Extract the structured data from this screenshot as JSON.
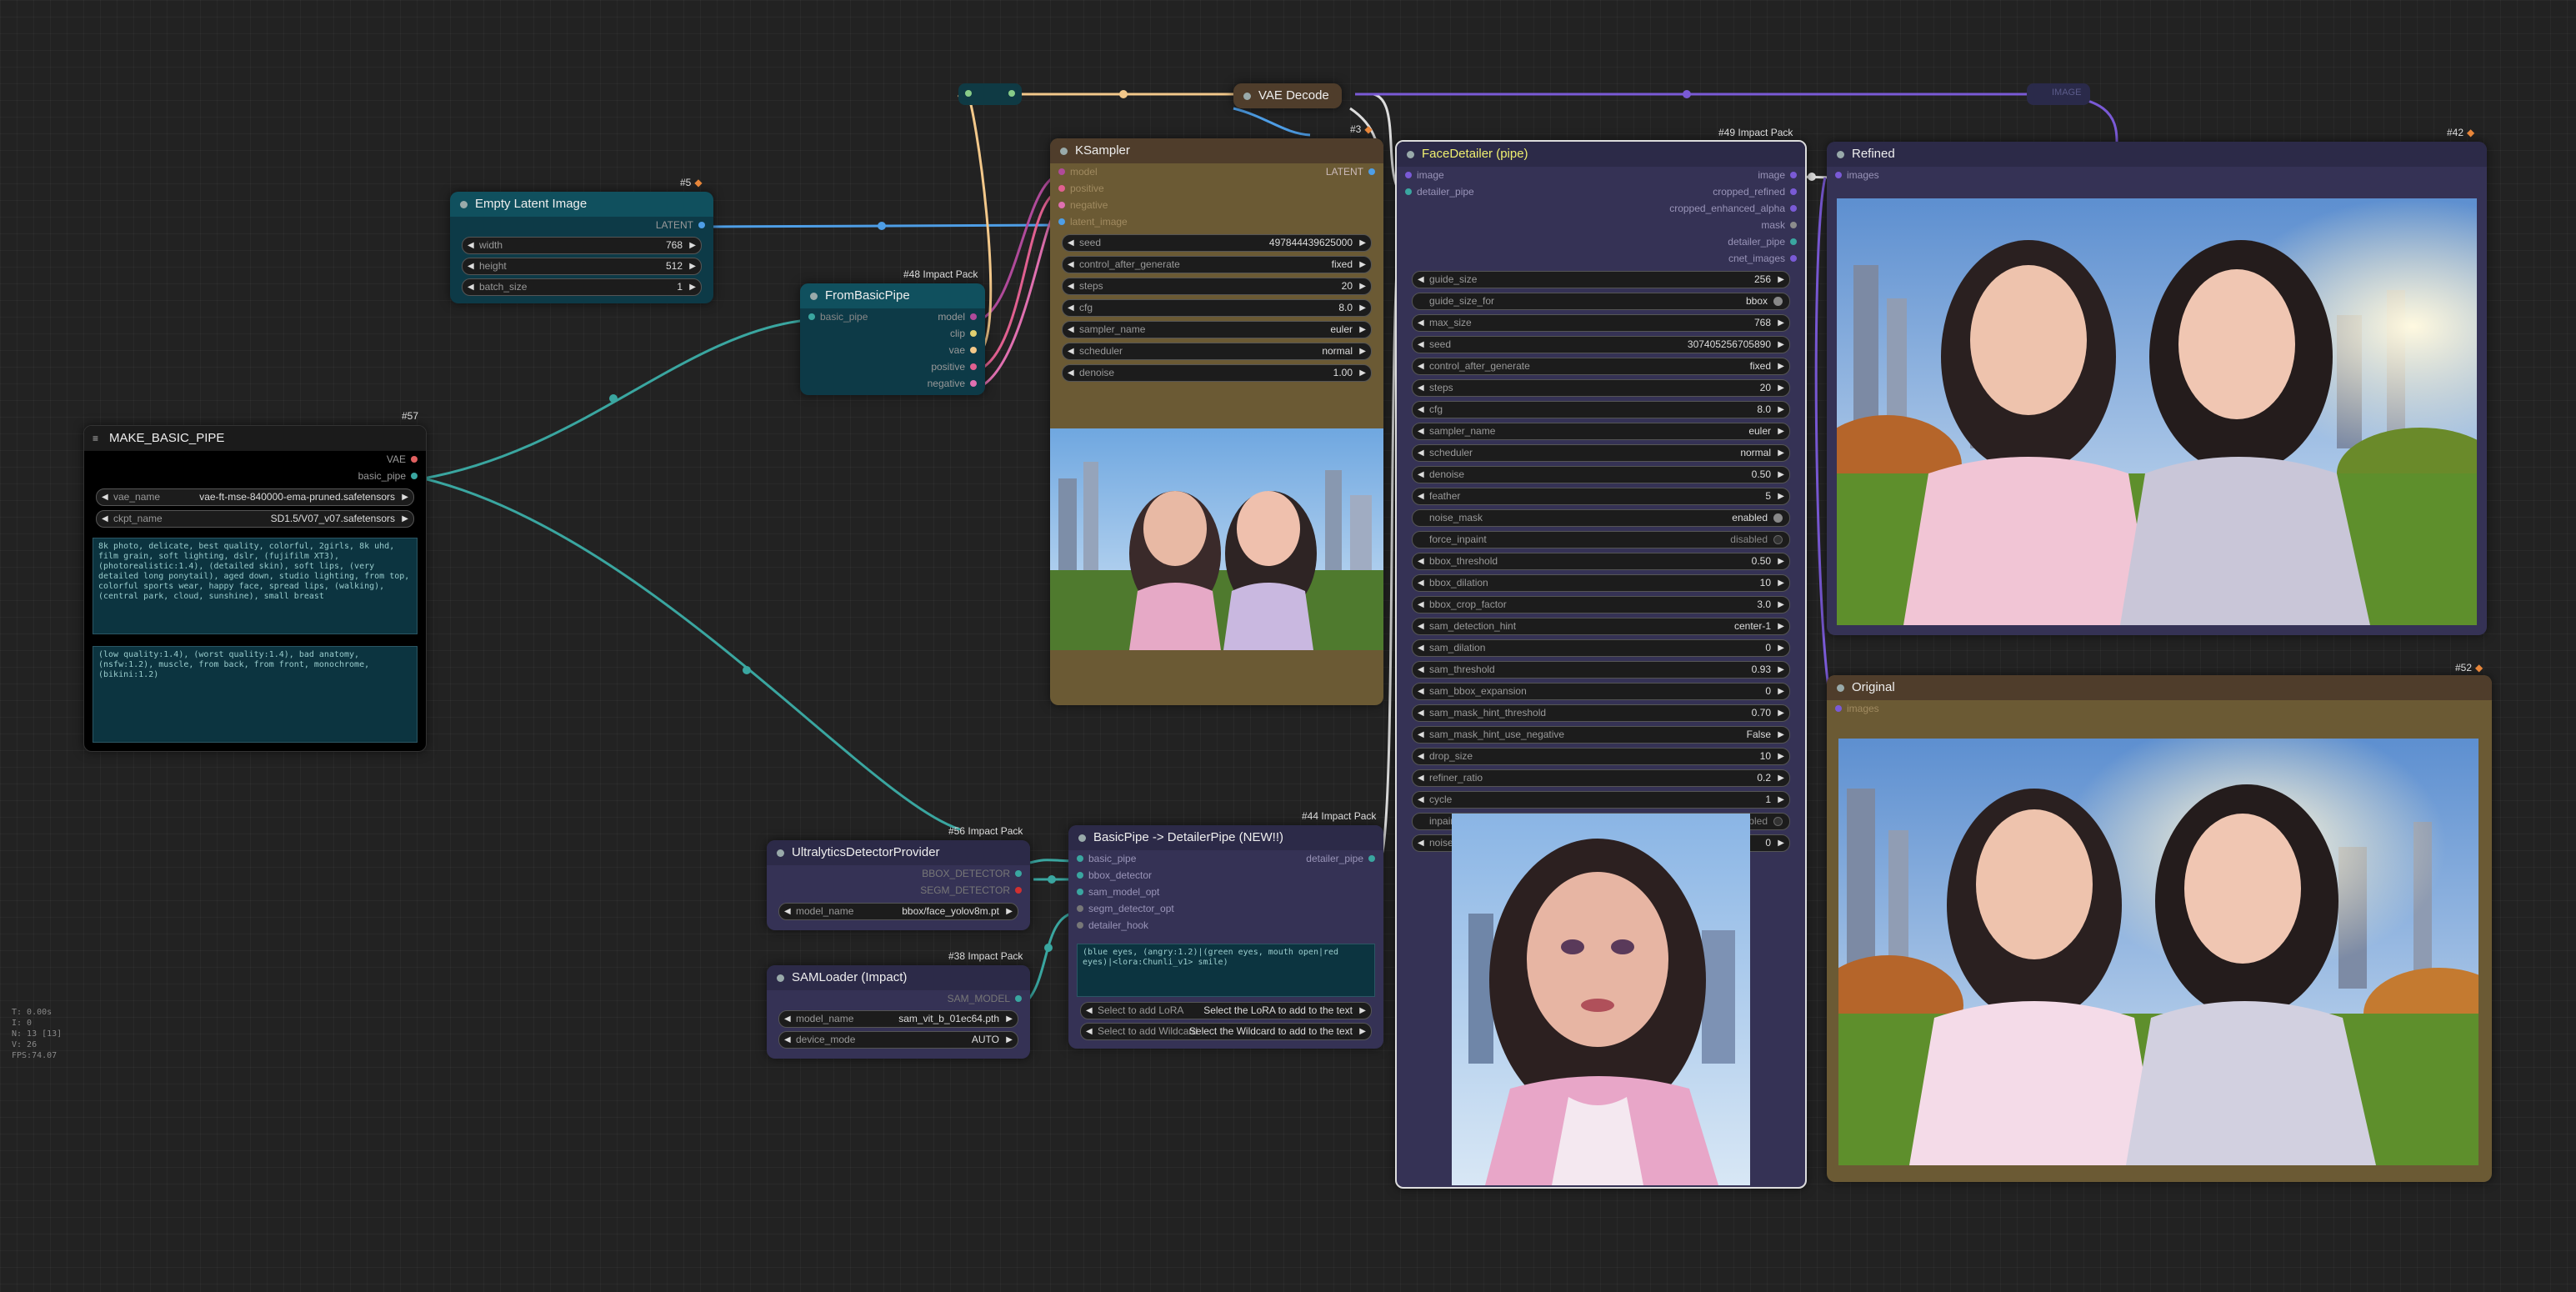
{
  "stats": {
    "lines": [
      "T: 0.00s",
      "I: 0",
      "N: 13 [13]",
      "V: 26",
      "FPS:74.07"
    ]
  },
  "groups": {
    "image_link_label": "IMAGE"
  },
  "colors": {
    "accent_link": "#3aa6a0",
    "latent_link": "#4e9ee6",
    "vae_link": "#e06060",
    "image_link": "#7a5ad6"
  },
  "nodes": {
    "make_basic_pipe": {
      "id": "#57",
      "title": "MAKE_BASIC_PIPE",
      "outputs": [
        "VAE",
        "basic_pipe"
      ],
      "widgets": [
        {
          "label": "vae_name",
          "value": "vae-ft-mse-840000-ema-pruned.safetensors"
        },
        {
          "label": "ckpt_name",
          "value": "SD1.5/V07_v07.safetensors"
        }
      ],
      "positive": "8k photo, delicate, best quality, colorful, 2girls, 8k uhd, film grain, soft lighting, dslr, (fujifilm XT3), (photorealistic:1.4), (detailed skin), soft lips, (very detailed long ponytail), aged down, studio lighting, from top, colorful sports wear, happy face, spread lips, (walking), (central park, cloud, sunshine), small breast",
      "negative": "(low quality:1.4), (worst quality:1.4), bad anatomy, (nsfw:1.2), muscle, from back, from front, monochrome, (bikini:1.2)"
    },
    "empty_latent": {
      "id": "#5",
      "title": "Empty Latent Image",
      "output": "LATENT",
      "widgets": [
        {
          "label": "width",
          "value": "768"
        },
        {
          "label": "height",
          "value": "512"
        },
        {
          "label": "batch_size",
          "value": "1"
        }
      ]
    },
    "from_basic_pipe": {
      "id": "#48 Impact Pack",
      "title": "FromBasicPipe",
      "input": "basic_pipe",
      "outputs": [
        "model",
        "clip",
        "vae",
        "positive",
        "negative"
      ]
    },
    "ksampler": {
      "id": "#3",
      "title": "KSampler",
      "inputs": [
        "model",
        "positive",
        "negative",
        "latent_image"
      ],
      "output": "LATENT",
      "widgets": [
        {
          "label": "seed",
          "value": "497844439625000"
        },
        {
          "label": "control_after_generate",
          "value": "fixed"
        },
        {
          "label": "steps",
          "value": "20"
        },
        {
          "label": "cfg",
          "value": "8.0"
        },
        {
          "label": "sampler_name",
          "value": "euler"
        },
        {
          "label": "scheduler",
          "value": "normal"
        },
        {
          "label": "denoise",
          "value": "1.00"
        }
      ]
    },
    "vae_decode": {
      "title": "VAE Decode"
    },
    "face_detailer": {
      "id": "#49 Impact Pack",
      "title": "FaceDetailer (pipe)",
      "inputs": [
        "image",
        "detailer_pipe"
      ],
      "outputs": [
        "image",
        "cropped_refined",
        "cropped_enhanced_alpha",
        "mask",
        "detailer_pipe",
        "cnet_images"
      ],
      "widgets": [
        {
          "label": "guide_size",
          "value": "256",
          "kind": "num"
        },
        {
          "label": "guide_size_for",
          "value": "bbox",
          "kind": "toggle"
        },
        {
          "label": "max_size",
          "value": "768",
          "kind": "num"
        },
        {
          "label": "seed",
          "value": "307405256705890",
          "kind": "num"
        },
        {
          "label": "control_after_generate",
          "value": "fixed",
          "kind": "num"
        },
        {
          "label": "steps",
          "value": "20",
          "kind": "num"
        },
        {
          "label": "cfg",
          "value": "8.0",
          "kind": "num"
        },
        {
          "label": "sampler_name",
          "value": "euler",
          "kind": "num"
        },
        {
          "label": "scheduler",
          "value": "normal",
          "kind": "num"
        },
        {
          "label": "denoise",
          "value": "0.50",
          "kind": "num"
        },
        {
          "label": "feather",
          "value": "5",
          "kind": "num"
        },
        {
          "label": "noise_mask",
          "value": "enabled",
          "kind": "toggle"
        },
        {
          "label": "force_inpaint",
          "value": "disabled",
          "kind": "toggle-off"
        },
        {
          "label": "bbox_threshold",
          "value": "0.50",
          "kind": "num"
        },
        {
          "label": "bbox_dilation",
          "value": "10",
          "kind": "num"
        },
        {
          "label": "bbox_crop_factor",
          "value": "3.0",
          "kind": "num"
        },
        {
          "label": "sam_detection_hint",
          "value": "center-1",
          "kind": "num"
        },
        {
          "label": "sam_dilation",
          "value": "0",
          "kind": "num"
        },
        {
          "label": "sam_threshold",
          "value": "0.93",
          "kind": "num"
        },
        {
          "label": "sam_bbox_expansion",
          "value": "0",
          "kind": "num"
        },
        {
          "label": "sam_mask_hint_threshold",
          "value": "0.70",
          "kind": "num"
        },
        {
          "label": "sam_mask_hint_use_negative",
          "value": "False",
          "kind": "num"
        },
        {
          "label": "drop_size",
          "value": "10",
          "kind": "num"
        },
        {
          "label": "refiner_ratio",
          "value": "0.2",
          "kind": "num"
        },
        {
          "label": "cycle",
          "value": "1",
          "kind": "num"
        },
        {
          "label": "inpaint_model",
          "value": "disabled",
          "kind": "toggle-off"
        },
        {
          "label": "noise_mask_feather",
          "value": "0",
          "kind": "num"
        }
      ]
    },
    "refined": {
      "id": "#42",
      "title": "Refined",
      "input": "images"
    },
    "original": {
      "id": "#52",
      "title": "Original",
      "input": "images"
    },
    "ultralytics": {
      "id": "#56 Impact Pack",
      "title": "UltralyticsDetectorProvider",
      "outputs": [
        "BBOX_DETECTOR",
        "SEGM_DETECTOR"
      ],
      "widgets": [
        {
          "label": "model_name",
          "value": "bbox/face_yolov8m.pt"
        }
      ]
    },
    "samloader": {
      "id": "#38 Impact Pack",
      "title": "SAMLoader (Impact)",
      "output": "SAM_MODEL",
      "widgets": [
        {
          "label": "model_name",
          "value": "sam_vit_b_01ec64.pth"
        },
        {
          "label": "device_mode",
          "value": "AUTO"
        }
      ]
    },
    "basicpipe_detailer": {
      "id": "#44 Impact Pack",
      "title": "BasicPipe -> DetailerPipe (NEW!!)",
      "inputs": [
        "basic_pipe",
        "bbox_detector",
        "sam_model_opt",
        "segm_detector_opt",
        "detailer_hook"
      ],
      "output": "detailer_pipe",
      "wildcard": "(blue eyes, (angry:1.2)|(green eyes, mouth open|red eyes)|<lora:Chunli_v1> smile)",
      "widgets": [
        {
          "label": "Select to add LoRA",
          "value": "Select the LoRA to add to the text"
        },
        {
          "label": "Select to add Wildcard",
          "value": "Select the Wildcard to add to the text"
        }
      ]
    }
  }
}
